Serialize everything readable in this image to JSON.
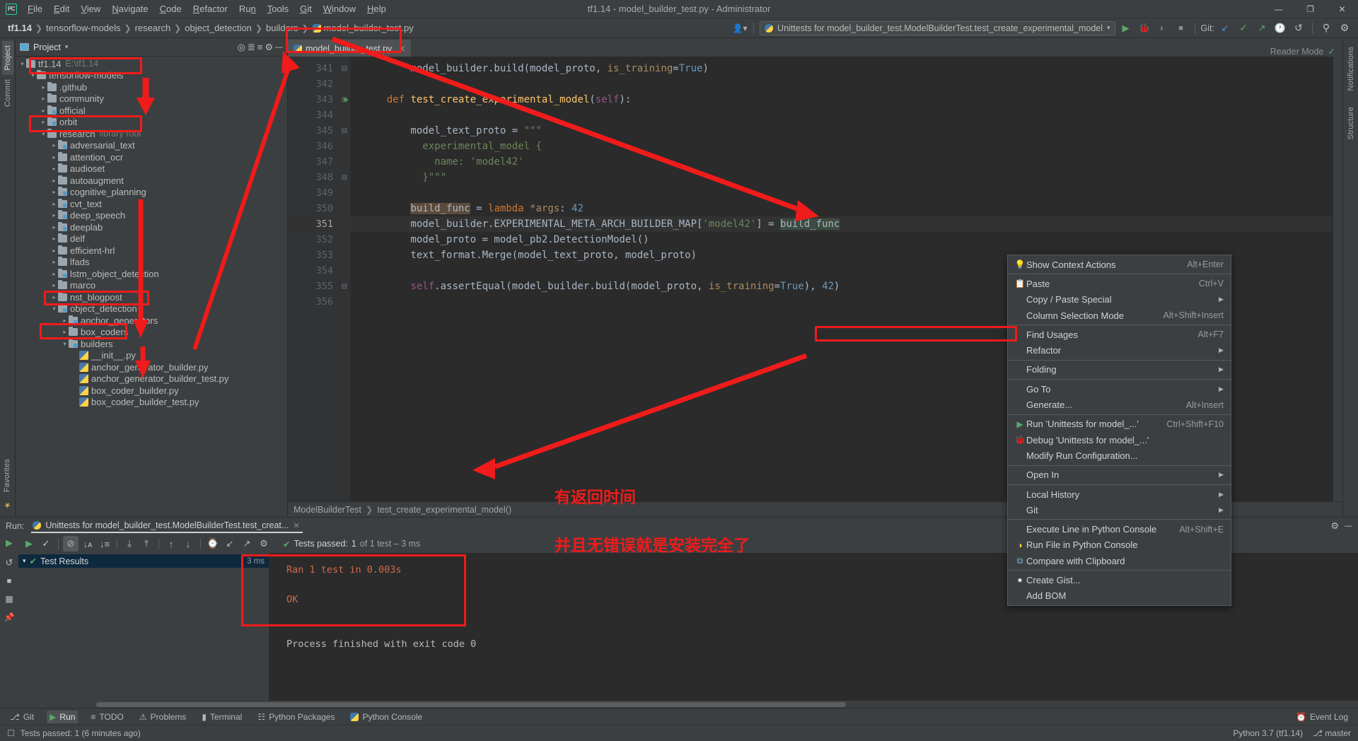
{
  "window": {
    "title": "tf1.14 - model_builder_test.py - Administrator",
    "logo": "pycharm-logo",
    "minimize": "—",
    "maximize": "❐",
    "close": "✕"
  },
  "menubar": [
    {
      "label": "File"
    },
    {
      "label": "Edit"
    },
    {
      "label": "View"
    },
    {
      "label": "Navigate"
    },
    {
      "label": "Code"
    },
    {
      "label": "Refactor"
    },
    {
      "label": "Run"
    },
    {
      "label": "Tools"
    },
    {
      "label": "Git"
    },
    {
      "label": "Window"
    },
    {
      "label": "Help"
    }
  ],
  "breadcrumbs": [
    {
      "label": "tf1.14",
      "bold": true
    },
    {
      "label": "tensorflow-models"
    },
    {
      "label": "research"
    },
    {
      "label": "object_detection"
    },
    {
      "label": "builders"
    },
    {
      "label": "model_builder_test.py",
      "icon": "python-file-icon"
    }
  ],
  "toolbar": {
    "run_config": "Unittests for model_builder_test.ModelBuilderTest.test_create_experimental_model",
    "run_config_icon": "python-test-icon",
    "run_label": "▶",
    "debug_label": "🐞",
    "coverage_label": "◗",
    "stop_label": "■",
    "git_label": "Git:",
    "git_update": "↙",
    "git_commit": "✓",
    "git_push": "↗",
    "history": "🕓",
    "rollback": "↺",
    "search": "⚲",
    "settings": "⚙",
    "profile_icon": "user-icon"
  },
  "left_rail": [
    {
      "label": "Project",
      "active": true
    },
    {
      "label": "Commit",
      "active": false
    }
  ],
  "right_rail": [
    {
      "label": "Notifications"
    }
  ],
  "project_panel": {
    "title": "Project",
    "caret": "▾",
    "tools": [
      "target-icon",
      "collapse-icon",
      "expand-icon",
      "settings-icon",
      "hide-icon"
    ],
    "tree": [
      {
        "indent": 0,
        "arrow": "open",
        "type": "folder",
        "name": "tf1.14",
        "note": "E:\\tf1.14"
      },
      {
        "indent": 1,
        "arrow": "open",
        "type": "folder",
        "name": "tensorflow-models",
        "note": ""
      },
      {
        "indent": 2,
        "arrow": "closed",
        "type": "folder",
        "name": ".github",
        "note": ""
      },
      {
        "indent": 2,
        "arrow": "closed",
        "type": "folder",
        "name": "community",
        "note": ""
      },
      {
        "indent": 2,
        "arrow": "closed",
        "type": "folder-mod",
        "name": "official",
        "note": ""
      },
      {
        "indent": 2,
        "arrow": "closed",
        "type": "folder-mod",
        "name": "orbit",
        "note": ""
      },
      {
        "indent": 2,
        "arrow": "open",
        "type": "folder",
        "name": "research",
        "note": "library root"
      },
      {
        "indent": 3,
        "arrow": "closed",
        "type": "folder-mod",
        "name": "adversarial_text",
        "note": ""
      },
      {
        "indent": 3,
        "arrow": "closed",
        "type": "folder",
        "name": "attention_ocr",
        "note": ""
      },
      {
        "indent": 3,
        "arrow": "closed",
        "type": "folder",
        "name": "audioset",
        "note": ""
      },
      {
        "indent": 3,
        "arrow": "closed",
        "type": "folder",
        "name": "autoaugment",
        "note": ""
      },
      {
        "indent": 3,
        "arrow": "closed",
        "type": "folder-mod",
        "name": "cognitive_planning",
        "note": ""
      },
      {
        "indent": 3,
        "arrow": "closed",
        "type": "folder-mod",
        "name": "cvt_text",
        "note": ""
      },
      {
        "indent": 3,
        "arrow": "closed",
        "type": "folder-mod",
        "name": "deep_speech",
        "note": ""
      },
      {
        "indent": 3,
        "arrow": "closed",
        "type": "folder-mod",
        "name": "deeplab",
        "note": ""
      },
      {
        "indent": 3,
        "arrow": "closed",
        "type": "folder",
        "name": "delf",
        "note": ""
      },
      {
        "indent": 3,
        "arrow": "closed",
        "type": "folder",
        "name": "efficient-hrl",
        "note": ""
      },
      {
        "indent": 3,
        "arrow": "closed",
        "type": "folder",
        "name": "lfads",
        "note": ""
      },
      {
        "indent": 3,
        "arrow": "closed",
        "type": "folder-mod",
        "name": "lstm_object_detection",
        "note": ""
      },
      {
        "indent": 3,
        "arrow": "closed",
        "type": "folder",
        "name": "marco",
        "note": ""
      },
      {
        "indent": 3,
        "arrow": "closed",
        "type": "folder",
        "name": "nst_blogpost",
        "note": ""
      },
      {
        "indent": 3,
        "arrow": "open",
        "type": "folder-mod",
        "name": "object_detection",
        "note": ""
      },
      {
        "indent": 4,
        "arrow": "closed",
        "type": "folder-mod",
        "name": "anchor_generators",
        "note": ""
      },
      {
        "indent": 4,
        "arrow": "closed",
        "type": "folder",
        "name": "box_coders",
        "note": ""
      },
      {
        "indent": 4,
        "arrow": "open",
        "type": "folder-mod",
        "name": "builders",
        "note": ""
      },
      {
        "indent": 5,
        "arrow": "none",
        "type": "py",
        "name": "__init__.py",
        "note": ""
      },
      {
        "indent": 5,
        "arrow": "none",
        "type": "py",
        "name": "anchor_generator_builder.py",
        "note": ""
      },
      {
        "indent": 5,
        "arrow": "none",
        "type": "py",
        "name": "anchor_generator_builder_test.py",
        "note": ""
      },
      {
        "indent": 5,
        "arrow": "none",
        "type": "py",
        "name": "box_coder_builder.py",
        "note": ""
      },
      {
        "indent": 5,
        "arrow": "none",
        "type": "py",
        "name": "box_coder_builder_test.py",
        "note": ""
      }
    ]
  },
  "editor": {
    "tab": {
      "label": "model_builder_test.py",
      "icon": "python-file-icon",
      "close": "✕"
    },
    "reader_mode": "Reader Mode",
    "first_line": 341,
    "current_line": 351,
    "lines": [
      {
        "n": 341,
        "fold": "⊟",
        "run": false,
        "html": "        model_builder.build(model_proto, is_training=True)"
      },
      {
        "n": 342,
        "fold": "",
        "run": false,
        "html": ""
      },
      {
        "n": 343,
        "fold": "⊟",
        "run": true,
        "html": "    def test_create_experimental_model(self):"
      },
      {
        "n": 344,
        "fold": "",
        "run": false,
        "html": ""
      },
      {
        "n": 345,
        "fold": "⊟",
        "run": false,
        "html": "        model_text_proto = \"\"\""
      },
      {
        "n": 346,
        "fold": "",
        "run": false,
        "html": "          experimental_model {"
      },
      {
        "n": 347,
        "fold": "",
        "run": false,
        "html": "            name: 'model42'"
      },
      {
        "n": 348,
        "fold": "⊟",
        "run": false,
        "html": "          }\"\"\""
      },
      {
        "n": 349,
        "fold": "",
        "run": false,
        "html": ""
      },
      {
        "n": 350,
        "fold": "",
        "run": false,
        "html": "        build_func = lambda *args: 42"
      },
      {
        "n": 351,
        "fold": "",
        "run": false,
        "html": "        model_builder.EXPERIMENTAL_META_ARCH_BUILDER_MAP['model42'] = build_func"
      },
      {
        "n": 352,
        "fold": "",
        "run": false,
        "html": "        model_proto = model_pb2.DetectionModel()"
      },
      {
        "n": 353,
        "fold": "",
        "run": false,
        "html": "        text_format.Merge(model_text_proto, model_proto)"
      },
      {
        "n": 354,
        "fold": "",
        "run": false,
        "html": ""
      },
      {
        "n": 355,
        "fold": "⊟",
        "run": false,
        "html": "        self.assertEqual(model_builder.build(model_proto, is_training=True), 42)"
      },
      {
        "n": 356,
        "fold": "",
        "run": false,
        "html": ""
      }
    ],
    "status_breadcrumbs": [
      "ModelBuilderTest",
      "test_create_experimental_model()"
    ]
  },
  "context_menu": [
    {
      "icon": "lightbulb-icon",
      "label": "Show Context Actions",
      "key": "Alt+Enter",
      "submenu": false,
      "sep_after": true
    },
    {
      "icon": "clipboard-icon",
      "label": "Paste",
      "key": "Ctrl+V",
      "submenu": false,
      "sep_after": false
    },
    {
      "icon": "",
      "label": "Copy / Paste Special",
      "key": "",
      "submenu": true,
      "sep_after": false
    },
    {
      "icon": "",
      "label": "Column Selection Mode",
      "key": "Alt+Shift+Insert",
      "submenu": false,
      "sep_after": true
    },
    {
      "icon": "",
      "label": "Find Usages",
      "key": "Alt+F7",
      "submenu": false,
      "sep_after": false
    },
    {
      "icon": "",
      "label": "Refactor",
      "key": "",
      "submenu": true,
      "sep_after": true
    },
    {
      "icon": "",
      "label": "Folding",
      "key": "",
      "submenu": true,
      "sep_after": true
    },
    {
      "icon": "",
      "label": "Go To",
      "key": "",
      "submenu": true,
      "sep_after": false
    },
    {
      "icon": "",
      "label": "Generate...",
      "key": "Alt+Insert",
      "submenu": false,
      "sep_after": true
    },
    {
      "icon": "run-icon",
      "label": "Run 'Unittests for model_...'",
      "key": "Ctrl+Shift+F10",
      "submenu": false,
      "sep_after": false,
      "highlight": true
    },
    {
      "icon": "debug-icon",
      "label": "Debug 'Unittests for model_...'",
      "key": "",
      "submenu": false,
      "sep_after": false
    },
    {
      "icon": "",
      "label": "Modify Run Configuration...",
      "key": "",
      "submenu": false,
      "sep_after": true
    },
    {
      "icon": "",
      "label": "Open In",
      "key": "",
      "submenu": true,
      "sep_after": true
    },
    {
      "icon": "",
      "label": "Local History",
      "key": "",
      "submenu": true,
      "sep_after": false
    },
    {
      "icon": "",
      "label": "Git",
      "key": "",
      "submenu": true,
      "sep_after": true
    },
    {
      "icon": "",
      "label": "Execute Line in Python Console",
      "key": "Alt+Shift+E",
      "submenu": false,
      "sep_after": false
    },
    {
      "icon": "python-icon",
      "label": "Run File in Python Console",
      "key": "",
      "submenu": false,
      "sep_after": false
    },
    {
      "icon": "compare-icon",
      "label": "Compare with Clipboard",
      "key": "",
      "submenu": false,
      "sep_after": true
    },
    {
      "icon": "github-icon",
      "label": "Create Gist...",
      "key": "",
      "submenu": false,
      "sep_after": false
    },
    {
      "icon": "",
      "label": "Add BOM",
      "key": "",
      "submenu": false,
      "sep_after": false
    }
  ],
  "run_window": {
    "label": "Run:",
    "tab": "Unittests for model_builder_test.ModelBuilderTest.test_creat...",
    "tab_icon": "python-test-icon",
    "tab_close": "✕",
    "toolbar": [
      {
        "icon": "rerun-icon",
        "name": "rerun"
      },
      {
        "icon": "check-icon",
        "name": "show-passed"
      },
      {
        "icon": "ignored-icon",
        "name": "show-ignored"
      },
      {
        "icon": "sort-alpha-icon",
        "name": "sort-alphabetically"
      },
      {
        "icon": "sort-duration-icon",
        "name": "sort-by-duration"
      },
      {
        "icon": "expand-all-icon",
        "name": "expand-all"
      },
      {
        "icon": "collapse-all-icon",
        "name": "collapse-all"
      },
      {
        "icon": "prev-icon",
        "name": "previous-occurrence"
      },
      {
        "icon": "next-icon",
        "name": "next-occurrence"
      },
      {
        "icon": "history-icon",
        "name": "test-history"
      },
      {
        "icon": "import-icon",
        "name": "import-tests"
      },
      {
        "icon": "export-icon",
        "name": "export-tests"
      },
      {
        "icon": "settings-icon",
        "name": "test-settings"
      }
    ],
    "status": {
      "check": "✔",
      "prefix": "Tests passed:",
      "value": "1",
      "suffix": "of 1 test – 3 ms"
    },
    "tree_row": {
      "caret": "▾",
      "check": "✔",
      "label": "Test Results",
      "duration": "3 ms"
    },
    "console": [
      "Ran 1 test in 0.003s",
      "",
      "OK",
      "",
      "",
      "Process finished with exit code 0"
    ],
    "console_colored_lines": [
      0,
      2
    ]
  },
  "status_tabs": {
    "left": [
      {
        "icon": "git-icon",
        "label": "Git"
      },
      {
        "icon": "run-icon",
        "label": "Run",
        "active": true
      },
      {
        "icon": "todo-icon",
        "label": "TODO"
      },
      {
        "icon": "problems-icon",
        "label": "Problems"
      },
      {
        "icon": "terminal-icon",
        "label": "Terminal"
      },
      {
        "icon": "package-icon",
        "label": "Python Packages"
      },
      {
        "icon": "python-icon",
        "label": "Python Console"
      }
    ],
    "right": [
      {
        "icon": "event-log-icon",
        "label": "Event Log"
      }
    ]
  },
  "status_bar": {
    "message": "Tests passed: 1 (6 minutes ago)",
    "message_icon": "info-icon",
    "interpreter": "Python 3.7 (tf1.14)",
    "branch": "master",
    "branch_icon": "branch-icon"
  },
  "annotations": {
    "note1": "有返回时间",
    "note2": "并且无错误就是安装完全了",
    "color": "#f01b1b"
  }
}
